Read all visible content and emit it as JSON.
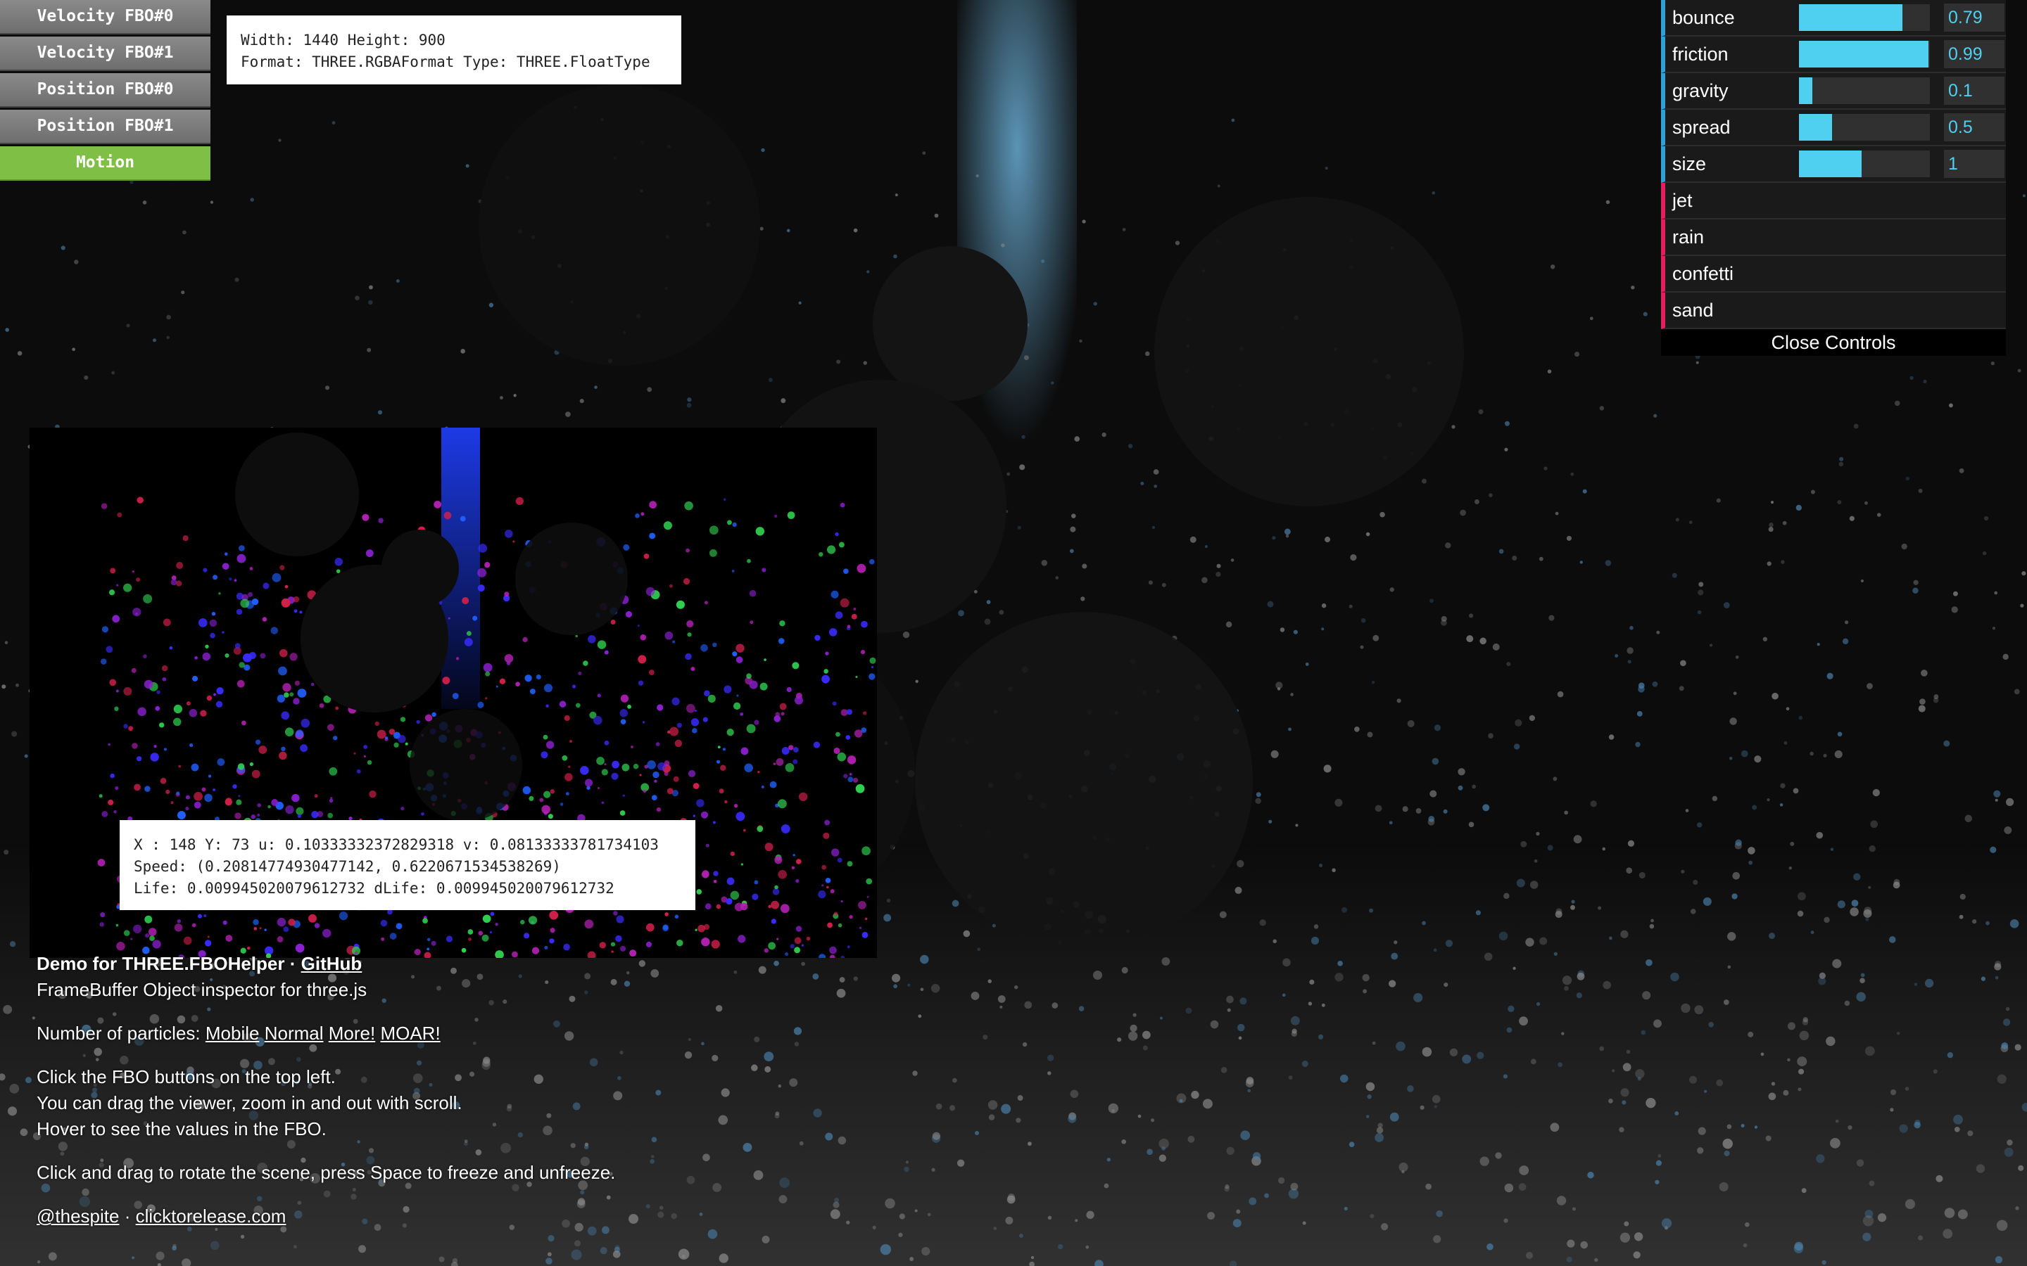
{
  "fbo_buttons": [
    {
      "label": "Velocity FBO#0",
      "active": false
    },
    {
      "label": "Velocity FBO#1",
      "active": false
    },
    {
      "label": "Position FBO#0",
      "active": false
    },
    {
      "label": "Position FBO#1",
      "active": false
    },
    {
      "label": "Motion",
      "active": true
    }
  ],
  "fbo_info": {
    "line1": "Width: 1440 Height: 900",
    "line2": "Format: THREE.RGBAFormat Type: THREE.FloatType"
  },
  "hover_tip": {
    "line1": "X : 148 Y: 73 u: 0.10333332372829318 v: 0.08133333781734103",
    "line2": "Speed: (0.20814774930477142, 0.6220671534538269)",
    "line3": "Life: 0.009945020079612732 dLife: 0.009945020079612732"
  },
  "controls": {
    "sliders": [
      {
        "label": "bounce",
        "value": "0.79",
        "fraction": 0.79
      },
      {
        "label": "friction",
        "value": "0.99",
        "fraction": 0.99
      },
      {
        "label": "gravity",
        "value": "0.1",
        "fraction": 0.1
      },
      {
        "label": "spread",
        "value": "0.5",
        "fraction": 0.25
      },
      {
        "label": "size",
        "value": "1",
        "fraction": 0.48
      }
    ],
    "functions": [
      "jet",
      "rain",
      "confetti",
      "sand"
    ],
    "close_label": "Close Controls"
  },
  "description": {
    "title": "Demo for THREE.FBOHelper",
    "separator": "·",
    "github_link": "GitHub",
    "subtitle": "FrameBuffer Object inspector for three.js",
    "particles_label": "Number of particles:",
    "particle_links": [
      "Mobile",
      "Normal",
      "More!",
      "MOAR!"
    ],
    "instructions": [
      "Click the FBO buttons on the top left.",
      "You can drag the viewer, zoom in and out with scroll.",
      "Hover to see the values in the FBO."
    ],
    "rotate_text": "Click and drag to rotate the scene, press Space to freeze and unfreeze.",
    "author_link": "@thespite",
    "author_sep": "·",
    "site_link": "clicktorelease.com"
  },
  "colors": {
    "accent_slider": "#4fd0f0",
    "number_border": "#2fa1d6",
    "function_border": "#e61d5f",
    "active_button": "#80bf45"
  }
}
